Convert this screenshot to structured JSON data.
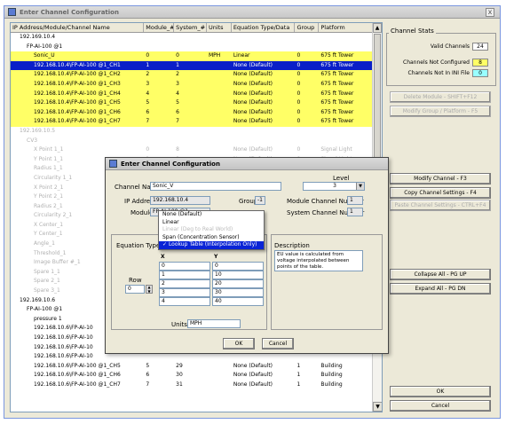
{
  "window": {
    "title": "Enter Channel Configuration",
    "close_glyph": "x"
  },
  "tree": {
    "columns": [
      "IP Address/Module/Channel Name",
      "Module_#",
      "System_#",
      "Units",
      "Equation Type/Data",
      "Group",
      "Platform"
    ],
    "rows": [
      {
        "name": "192.169.10.4",
        "indent": 1,
        "cells": [
          "",
          "",
          "",
          "",
          "",
          ""
        ],
        "style": ""
      },
      {
        "name": "FP-AI-100 @1",
        "indent": 2,
        "cells": [
          "",
          "",
          "",
          "",
          "",
          ""
        ],
        "style": ""
      },
      {
        "name": "Sonic_U",
        "indent": 3,
        "cells": [
          "0",
          "0",
          "MPH",
          "Linear",
          "0",
          "675 ft Tower"
        ],
        "style": "y"
      },
      {
        "name": "192.168.10.4\\FP-AI-100 @1_CH1",
        "indent": 3,
        "cells": [
          "1",
          "1",
          "",
          "None (Default)",
          "0",
          "675 ft Tower"
        ],
        "style": "sel"
      },
      {
        "name": "192.168.10.4\\FP-AI-100 @1_CH2",
        "indent": 3,
        "cells": [
          "2",
          "2",
          "",
          "None (Default)",
          "0",
          "675 ft Tower"
        ],
        "style": "y"
      },
      {
        "name": "192.168.10.4\\FP-AI-100 @1_CH3",
        "indent": 3,
        "cells": [
          "3",
          "3",
          "",
          "None (Default)",
          "0",
          "675 ft Tower"
        ],
        "style": "y"
      },
      {
        "name": "192.168.10.4\\FP-AI-100 @1_CH4",
        "indent": 3,
        "cells": [
          "4",
          "4",
          "",
          "None (Default)",
          "0",
          "675 ft Tower"
        ],
        "style": "y"
      },
      {
        "name": "192.168.10.4\\FP-AI-100 @1_CH5",
        "indent": 3,
        "cells": [
          "5",
          "5",
          "",
          "None (Default)",
          "0",
          "675 ft Tower"
        ],
        "style": "y"
      },
      {
        "name": "192.168.10.4\\FP-AI-100 @1_CH6",
        "indent": 3,
        "cells": [
          "6",
          "6",
          "",
          "None (Default)",
          "0",
          "675 ft Tower"
        ],
        "style": "y"
      },
      {
        "name": "192.168.10.4\\FP-AI-100 @1_CH7",
        "indent": 3,
        "cells": [
          "7",
          "7",
          "",
          "None (Default)",
          "0",
          "675 ft Tower"
        ],
        "style": "y"
      },
      {
        "name": "192.169.10.5",
        "indent": 1,
        "cells": [
          "",
          "",
          "",
          "",
          "",
          ""
        ],
        "style": "dim"
      },
      {
        "name": "CV3",
        "indent": 2,
        "cells": [
          "",
          "",
          "",
          "",
          "",
          ""
        ],
        "style": "dim"
      },
      {
        "name": "X Point 1_1",
        "indent": 3,
        "cells": [
          "0",
          "8",
          "",
          "None (Default)",
          "0",
          "Signal Light"
        ],
        "style": "dim"
      },
      {
        "name": "Y Point 1_1",
        "indent": 3,
        "cells": [
          "1",
          "9",
          "",
          "None (Default)",
          "0",
          "Signal Light"
        ],
        "style": "dim"
      },
      {
        "name": "Radius 1_1",
        "indent": 3,
        "cells": [
          "",
          "",
          "",
          "",
          "",
          ""
        ],
        "style": "dim"
      },
      {
        "name": "Circularity 1_1",
        "indent": 3,
        "cells": [
          "",
          "",
          "",
          "",
          "",
          ""
        ],
        "style": "dim"
      },
      {
        "name": "X Point 2_1",
        "indent": 3,
        "cells": [
          "",
          "",
          "",
          "",
          "",
          ""
        ],
        "style": "dim"
      },
      {
        "name": "Y Point 2_1",
        "indent": 3,
        "cells": [
          "",
          "",
          "",
          "",
          "",
          ""
        ],
        "style": "dim"
      },
      {
        "name": "Radius 2_1",
        "indent": 3,
        "cells": [
          "",
          "",
          "",
          "",
          "",
          ""
        ],
        "style": "dim"
      },
      {
        "name": "Circularity 2_1",
        "indent": 3,
        "cells": [
          "",
          "",
          "",
          "",
          "",
          ""
        ],
        "style": "dim"
      },
      {
        "name": "X Center_1",
        "indent": 3,
        "cells": [
          "",
          "",
          "",
          "",
          "",
          ""
        ],
        "style": "dim"
      },
      {
        "name": "Y Center_1",
        "indent": 3,
        "cells": [
          "",
          "",
          "",
          "",
          "",
          ""
        ],
        "style": "dim"
      },
      {
        "name": "Angle_1",
        "indent": 3,
        "cells": [
          "",
          "",
          "",
          "",
          "",
          ""
        ],
        "style": "dim"
      },
      {
        "name": "Threshold_1",
        "indent": 3,
        "cells": [
          "",
          "",
          "",
          "",
          "",
          ""
        ],
        "style": "dim"
      },
      {
        "name": "Image Buffer #_1",
        "indent": 3,
        "cells": [
          "",
          "",
          "",
          "",
          "",
          ""
        ],
        "style": "dim"
      },
      {
        "name": "Spare 1_1",
        "indent": 3,
        "cells": [
          "",
          "",
          "",
          "",
          "",
          ""
        ],
        "style": "dim"
      },
      {
        "name": "Spare 2_1",
        "indent": 3,
        "cells": [
          "",
          "",
          "",
          "",
          "",
          ""
        ],
        "style": "dim"
      },
      {
        "name": "Spare 3_1",
        "indent": 3,
        "cells": [
          "",
          "",
          "",
          "",
          "",
          ""
        ],
        "style": "dim"
      },
      {
        "name": "192.169.10.6",
        "indent": 1,
        "cells": [
          "",
          "",
          "",
          "",
          "",
          ""
        ],
        "style": ""
      },
      {
        "name": "FP-AI-100 @1",
        "indent": 2,
        "cells": [
          "",
          "",
          "",
          "",
          "",
          ""
        ],
        "style": ""
      },
      {
        "name": "pressure 1",
        "indent": 3,
        "cells": [
          "",
          "",
          "",
          "",
          "",
          ""
        ],
        "style": ""
      },
      {
        "name": "192.168.10.6\\FP-AI-10",
        "indent": 3,
        "cells": [
          "",
          "",
          "",
          "",
          "",
          ""
        ],
        "style": ""
      },
      {
        "name": "192.168.10.6\\FP-AI-10",
        "indent": 3,
        "cells": [
          "",
          "",
          "",
          "",
          "",
          ""
        ],
        "style": ""
      },
      {
        "name": "192.168.10.6\\FP-AI-10",
        "indent": 3,
        "cells": [
          "",
          "",
          "",
          "",
          "",
          ""
        ],
        "style": ""
      },
      {
        "name": "192.168.10.6\\FP-AI-10",
        "indent": 3,
        "cells": [
          "",
          "",
          "",
          "",
          "",
          ""
        ],
        "style": ""
      },
      {
        "name": "192.168.10.6\\FP-AI-100 @1_CH5",
        "indent": 3,
        "cells": [
          "5",
          "29",
          "",
          "None (Default)",
          "1",
          "Building"
        ],
        "style": ""
      },
      {
        "name": "192.168.10.6\\FP-AI-100 @1_CH6",
        "indent": 3,
        "cells": [
          "6",
          "30",
          "",
          "None (Default)",
          "1",
          "Building"
        ],
        "style": ""
      },
      {
        "name": "192.168.10.6\\FP-AI-100 @1_CH7",
        "indent": 3,
        "cells": [
          "7",
          "31",
          "",
          "None (Default)",
          "1",
          "Building"
        ],
        "style": ""
      }
    ]
  },
  "stats": {
    "title": "Channel Stats",
    "valid_label": "Valid Channels",
    "valid_value": "24",
    "not_configured_label": "Channels Not Configured",
    "not_configured_value": "8",
    "not_in_file_label": "Channels Not In INI File",
    "not_in_file_value": "0",
    "colors": {
      "not_configured": "#ffff66",
      "not_in_file": "#99ffff"
    }
  },
  "buttons": {
    "delete_module": "Delete Module - SHIFT+F12",
    "modify_group": "Modify Group / Platform - F5",
    "modify_channel": "Modify Channel - F3",
    "copy_settings": "Copy Channel Settings - F4",
    "paste_settings": "Paste Channel Settings - CTRL+F4",
    "collapse_all": "Collapse All - PG UP",
    "expand_all": "Expand All - PG DN",
    "ok": "OK",
    "cancel": "Cancel"
  },
  "dialog": {
    "title": "Enter Channel Configuration",
    "channel_name_label": "Channel Name",
    "channel_name_value": "Sonic_V",
    "level_label": "Level",
    "level_value": "3",
    "ip_label": "IP Address",
    "ip_value": "192.168.10.4",
    "group_label": "Group",
    "group_value": "-1",
    "module_label": "Module",
    "module_value": "FP-AI-100 @1",
    "module_channel_label": "Module Channel Number",
    "module_channel_value": "1",
    "system_channel_label": "System Channel Number",
    "system_channel_value": "1",
    "equation_label": "Equation Type",
    "equation_options": [
      "None (Default)",
      "Linear",
      "Linear (Deg to Real World)",
      "Span (Concentration Sensor)",
      "Lookup Table (Interpolation Only)"
    ],
    "description_label": "Description",
    "description_text": "EU value is calculated from voltage interpolated between points of the table.",
    "x_header": "X",
    "y_header": "Y",
    "table": [
      [
        "0",
        "0"
      ],
      [
        "1",
        "10"
      ],
      [
        "2",
        "20"
      ],
      [
        "3",
        "30"
      ],
      [
        "4",
        "40"
      ]
    ],
    "row_label": "Row",
    "row_value": "0",
    "units_label": "Units",
    "units_value": "MPH",
    "ok": "OK",
    "cancel": "Cancel"
  }
}
